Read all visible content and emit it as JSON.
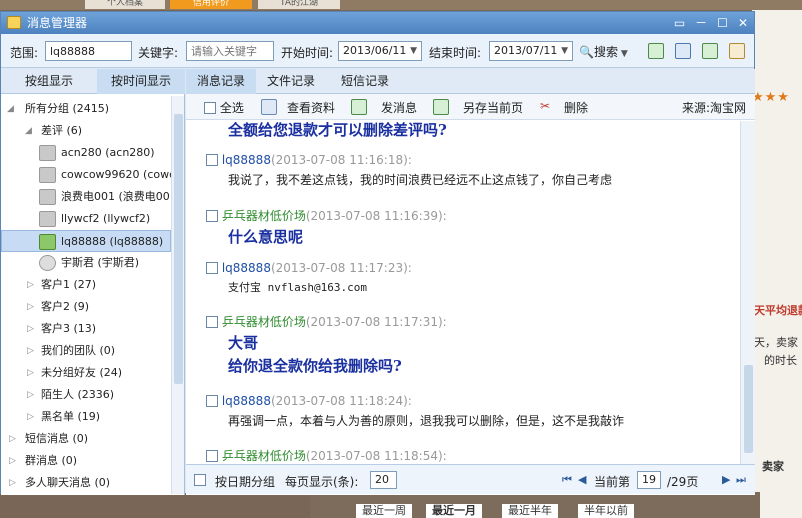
{
  "background": {
    "tabs": [
      "个人档案",
      "信用评价",
      "TA的江湖"
    ],
    "stars": "★★★",
    "side_texts": [
      "天平均退款",
      "天，卖家",
      "的时长",
      "卖家"
    ],
    "bottom_tabs": [
      "最近一周",
      "最近一月",
      "最近半年",
      "半年以前"
    ]
  },
  "window": {
    "title": "消息管理器",
    "controls": [
      "▭",
      "－",
      "☐",
      "✕"
    ]
  },
  "filter": {
    "scope_label": "范围:",
    "scope_value": "lq88888",
    "keyword_label": "关键字:",
    "keyword_placeholder": "请输入关键字",
    "start_label": "开始时间:",
    "start_value": "2013/06/11",
    "end_label": "结束时间:",
    "end_value": "2013/07/11",
    "search_label": "搜索"
  },
  "left_tabs": [
    "按组显示",
    "按时间显示"
  ],
  "tree": {
    "all": "所有分组 (2415)",
    "bad_review": "差评 (6)",
    "contacts": [
      "acn280 (acn280)",
      "cowcow99620 (cowcow",
      "浪费电001 (浪费电00",
      "llywcf2 (llywcf2)",
      "lq88888 (lq88888)",
      "宇斯君 (宇斯君)"
    ],
    "groups": [
      "客户1 (27)",
      "客户2 (9)",
      "客户3 (13)",
      "我们的团队 (0)",
      "未分组好友 (24)",
      "陌生人 (2336)",
      "黑名单 (19)"
    ],
    "top": [
      "短信消息 (0)",
      "群消息 (0)",
      "多人聊天消息 (0)"
    ]
  },
  "main_tabs": [
    "消息记录",
    "文件记录",
    "短信记录"
  ],
  "toolbar": {
    "select_all": "全选",
    "view_profile": "查看资料",
    "send_msg": "发消息",
    "save_page": "另存当前页",
    "delete": "删除",
    "source": "来源:淘宝网"
  },
  "messages": [
    {
      "body": "全额给您退款才可以删除差评吗?"
    },
    {
      "sender": "lq88888",
      "time": "(2013-07-08 11:16:18):",
      "body": "我说了，我不差这点钱，我的时间浪费已经远不止这点钱了，你自己考虑"
    },
    {
      "sender": "乒乓器材低价场",
      "time": "(2013-07-08 11:16:39):",
      "body": "什么意思呢"
    },
    {
      "sender": "lq88888",
      "time": "(2013-07-08 11:17:23):",
      "body": "支付宝 nvflash@163.com"
    },
    {
      "sender": "乒乓器材低价场",
      "time": "(2013-07-08 11:17:31):",
      "body1": "大哥",
      "body2": "给你退全款你给我删除吗?"
    },
    {
      "sender": "lq88888",
      "time": "(2013-07-08 11:18:24):",
      "body": "再强调一点，本着与人为善的原则，退我我可以删除，但是，这不是我敲诈"
    },
    {
      "sender": "乒乓器材低价场",
      "time": "(2013-07-08 11:18:54):"
    }
  ],
  "footer": {
    "by_date": "按日期分组",
    "per_page_label": "每页显示(条):",
    "per_page": "20",
    "current_label": "当前第",
    "current": "19",
    "total": "/29页"
  }
}
